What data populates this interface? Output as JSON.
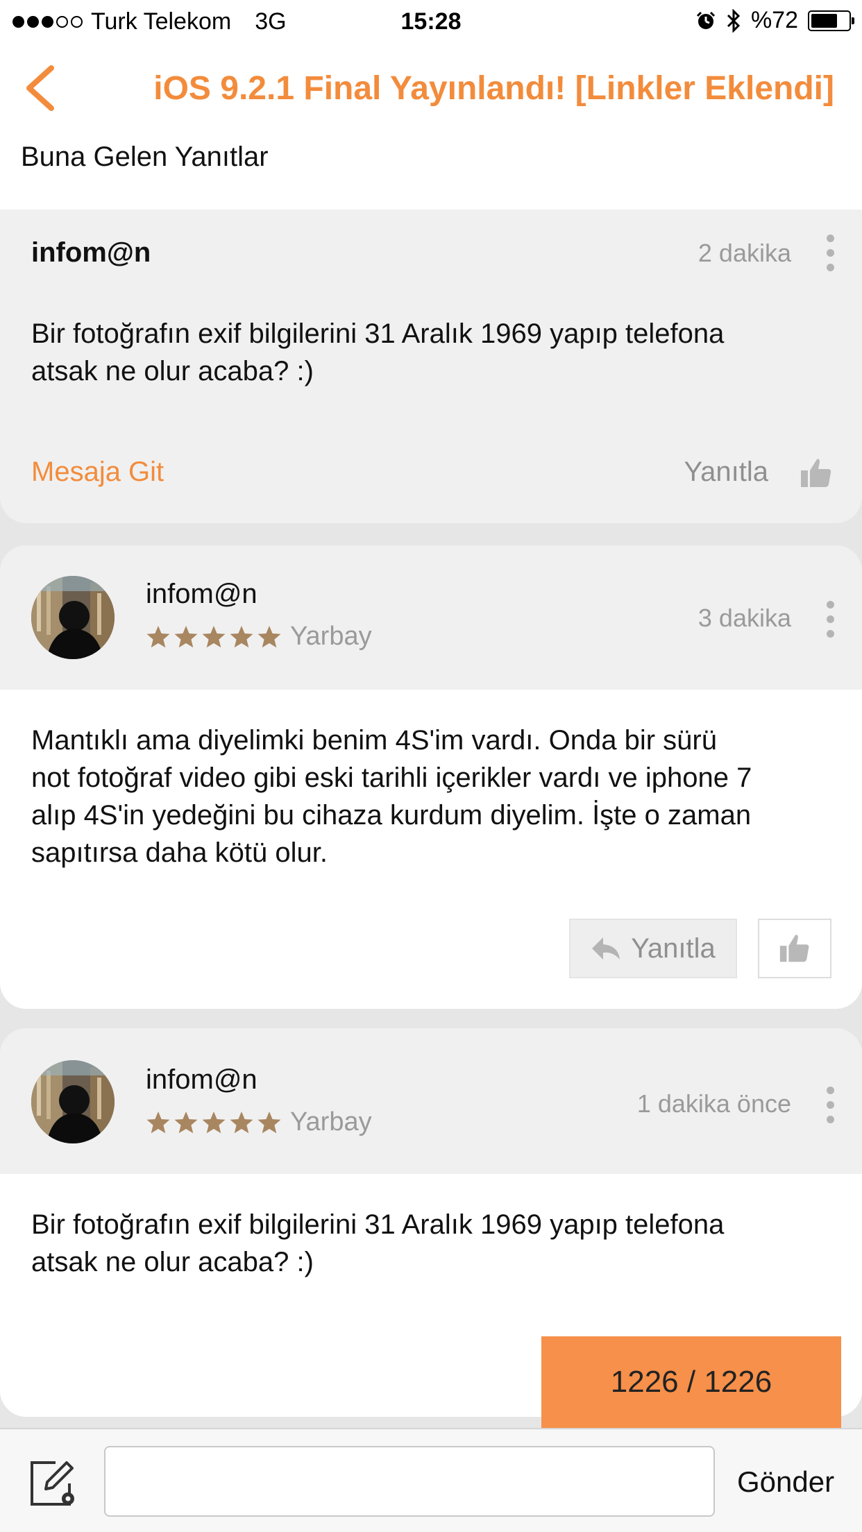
{
  "status_bar": {
    "carrier": "Turk Telekom",
    "network": "3G",
    "time": "15:28",
    "battery_text": "%72",
    "battery_level": 0.72,
    "signal_bars_filled": 3,
    "signal_bars_total": 5
  },
  "nav": {
    "back_icon": "chevron-left-icon",
    "title": "iOS 9.2.1 Final Yayınlandı! [Linkler Eklendi]"
  },
  "section_title": "Buna Gelen Yanıtlar",
  "quoted_post": {
    "author": "infom@n",
    "time": "2 dakika",
    "message_line1": "Bir fotoğrafın exif bilgilerini 31 Aralık 1969 yapıp telefona",
    "message_line2": "atsak ne olur acaba? :)",
    "goto_label": "Mesaja Git",
    "reply_label": "Yanıtla"
  },
  "replies": [
    {
      "author": "infom@n",
      "rank": "Yarbay",
      "stars": 5,
      "time": "3 dakika",
      "lines": [
        "Mantıklı ama  diyelimki benim 4S'im vardı.  Onda bir sürü",
        "not fotoğraf video gibi eski tarihli içerikler vardı ve iphone 7",
        "alıp 4S'in yedeğini bu cihaza kurdum diyelim.  İşte o zaman",
        "sapıtırsa daha kötü olur."
      ],
      "reply_label": "Yanıtla"
    },
    {
      "author": "infom@n",
      "rank": "Yarbay",
      "stars": 5,
      "time": "1 dakika önce",
      "lines": [
        "Bir fotoğrafın exif bilgilerini 31 Aralık 1969 yapıp telefona",
        "atsak ne olur acaba? :)"
      ]
    }
  ],
  "page_counter": "1226 / 1226",
  "composer": {
    "input_value": "",
    "send_label": "Gönder"
  },
  "colors": {
    "accent": "#f28c3c",
    "counter_bg": "#f6904a",
    "star": "#a88660"
  }
}
